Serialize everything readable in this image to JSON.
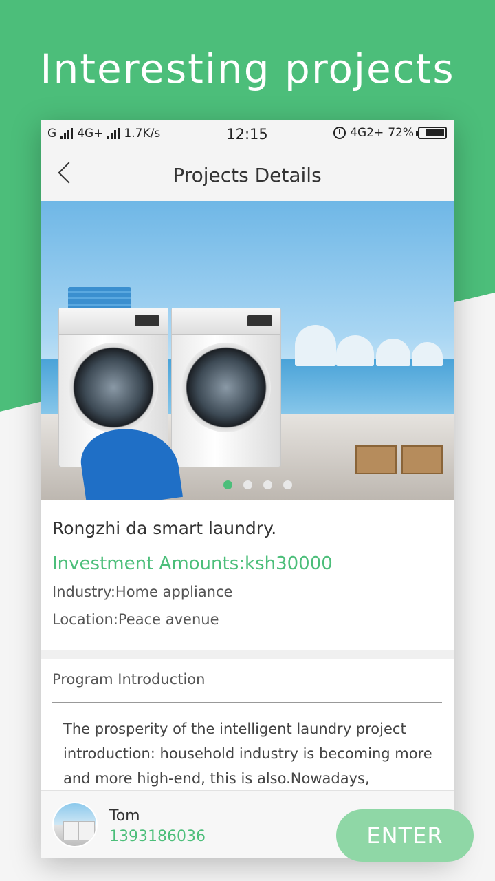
{
  "headline": "Interesting projects",
  "status_bar": {
    "network_1": "G",
    "network_2": "4G+",
    "speed": "1.7K/s",
    "time": "12:15",
    "network_3": "4G2+",
    "battery": "72%"
  },
  "nav": {
    "title": "Projects Details"
  },
  "carousel": {
    "total": 4,
    "active_index": 0
  },
  "project": {
    "name": "Rongzhi da smart laundry.",
    "investment": "Investment Amounts:ksh30000",
    "industry": "Industry:Home appliance",
    "location": "Location:Peace avenue"
  },
  "intro": {
    "title": "Program Introduction",
    "body": "The prosperity of the intelligent laundry project introduction: household industry is becoming more and more high-end, this is also.Nowadays,"
  },
  "contact": {
    "name": "Tom",
    "phone": "1393186036"
  },
  "actions": {
    "enter_label": "ENTER"
  },
  "colors": {
    "accent": "#4cbe7a",
    "button": "#8fd7a6"
  }
}
